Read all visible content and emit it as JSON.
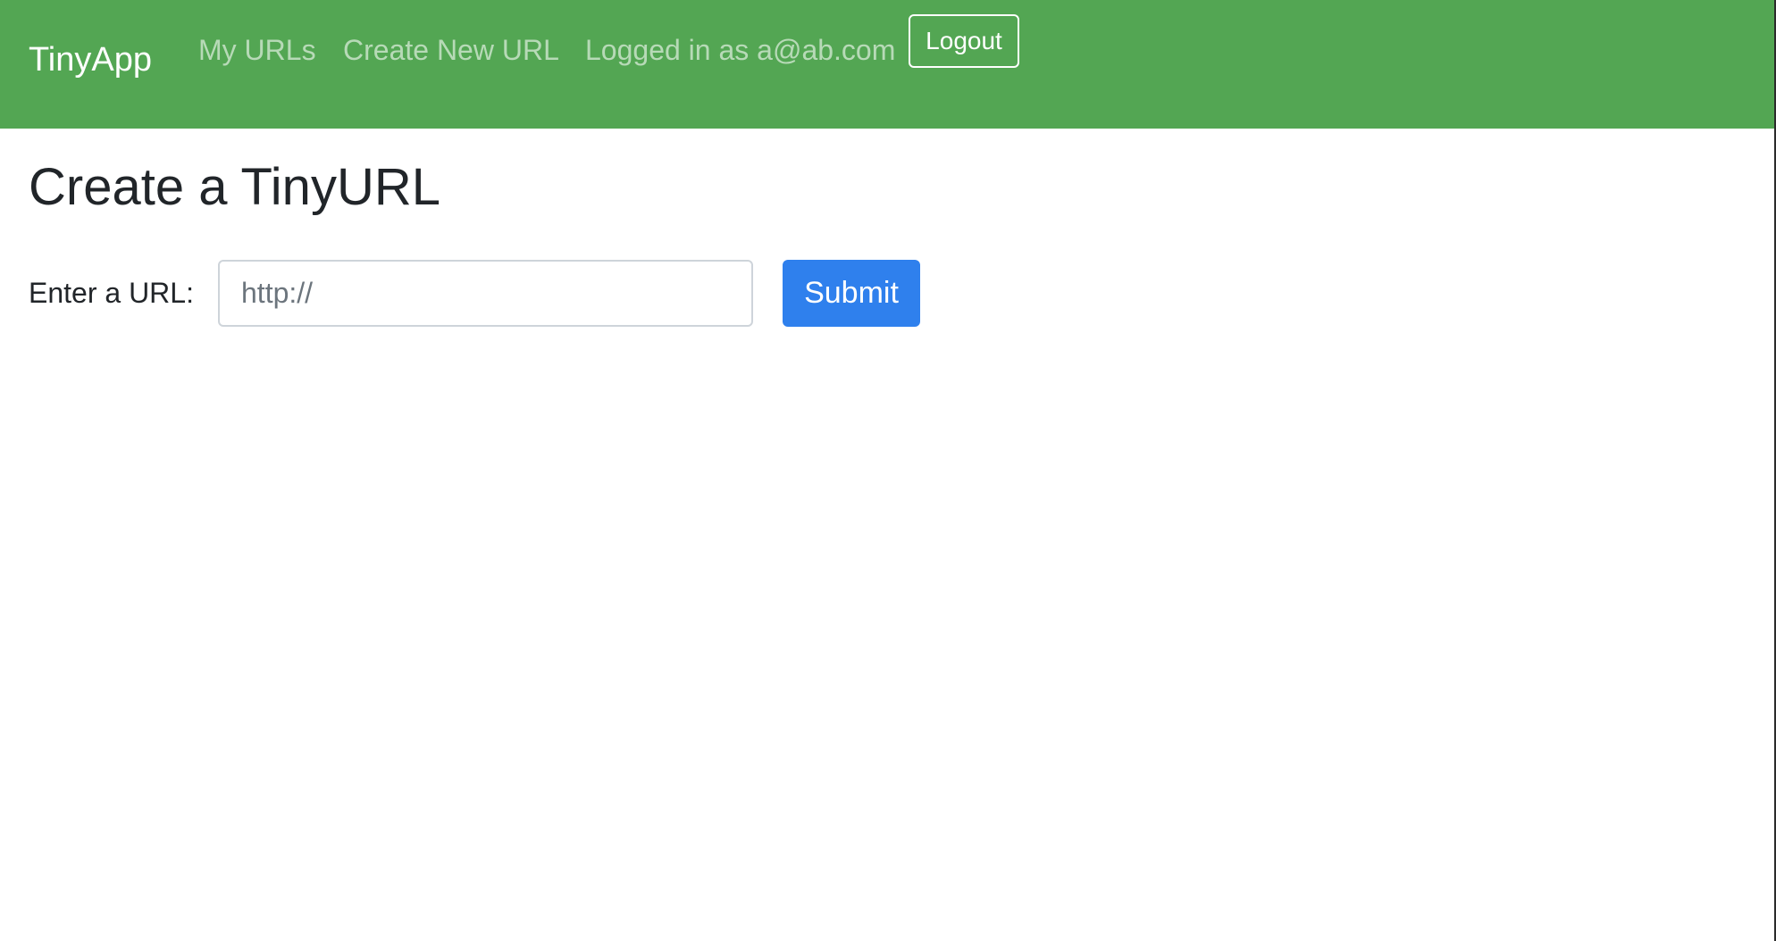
{
  "navbar": {
    "brand": "TinyApp",
    "links": [
      {
        "label": "My URLs"
      },
      {
        "label": "Create New URL"
      }
    ],
    "user_status": "Logged in as a@ab.com",
    "logout_label": "Logout"
  },
  "main": {
    "title": "Create a TinyURL",
    "form": {
      "label": "Enter a URL:",
      "input_value": "",
      "input_placeholder": "http://",
      "submit_label": "Submit"
    }
  },
  "colors": {
    "navbar_bg": "#53a653",
    "submit_bg": "#2f80ed",
    "heading_text": "#212529"
  }
}
